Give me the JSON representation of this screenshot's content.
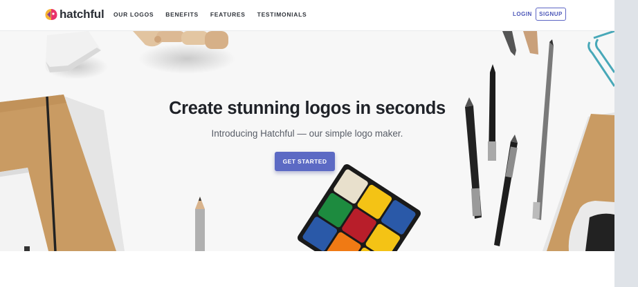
{
  "brand": {
    "name": "hatchful"
  },
  "nav": {
    "items": [
      "OUR LOGOS",
      "BENEFITS",
      "FEATURES",
      "TESTIMONIALS"
    ]
  },
  "auth": {
    "login": "LOGIN",
    "signup": "SIGNUP"
  },
  "hero": {
    "title": "Create stunning logos in seconds",
    "subtitle": "Introducing Hatchful — our simple logo maker.",
    "cta": "GET STARTED"
  },
  "colors": {
    "accent": "#5c6ac4",
    "text": "#1f2228",
    "background": "#f7f7f7"
  },
  "icons": [
    "hatchful-logo-icon"
  ]
}
